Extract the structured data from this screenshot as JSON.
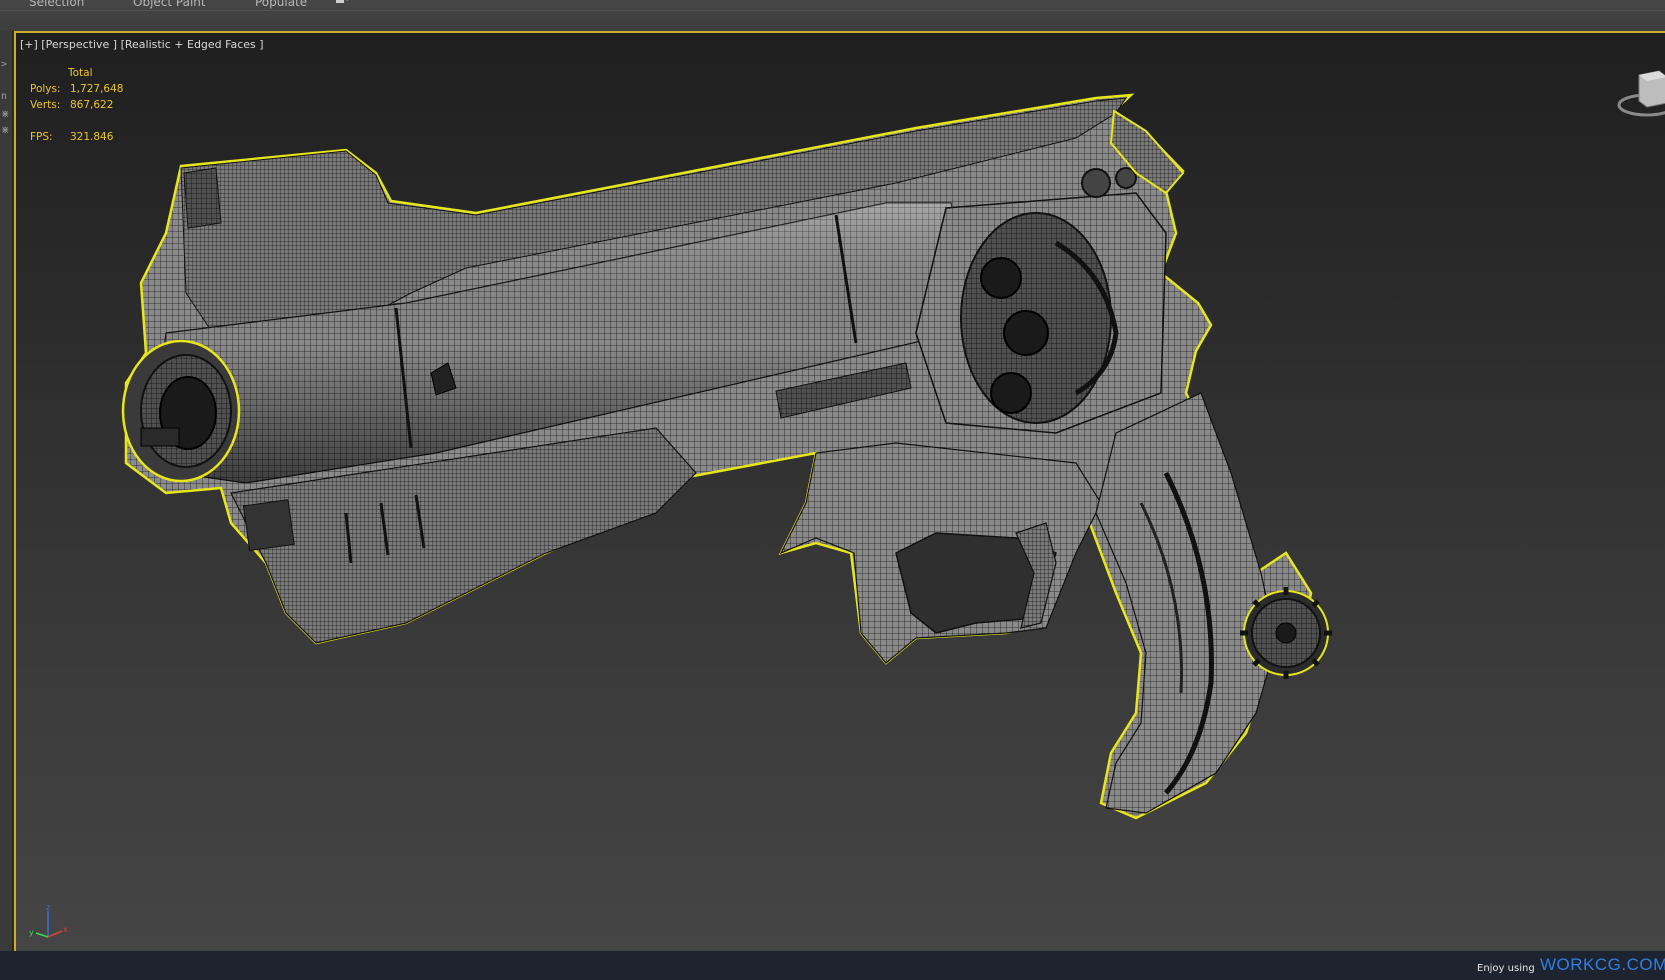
{
  "ribbon": {
    "tabs": [
      "Selection",
      "Object Paint",
      "Populate"
    ]
  },
  "viewport": {
    "label": "[+] [Perspective ] [Realistic + Edged Faces ]",
    "selection_highlight_color": "#e6e61a",
    "border_color": "#c9ad2b"
  },
  "stats": {
    "header": "Total",
    "polys_label": "Polys:",
    "polys_value": "1,727,648",
    "verts_label": "Verts:",
    "verts_value": "867,622",
    "fps_label": "FPS:",
    "fps_value": "321.846",
    "color": "#e8c52c"
  },
  "model": {
    "name": "revolver-wireframe-model"
  },
  "axis": {
    "x": "x",
    "y": "y",
    "z": "z"
  },
  "status": {
    "enjoy": "Enjoy using",
    "brand": "WORKCG.COM"
  },
  "icons": [
    "viewcube-icon",
    "axis-tripod-icon",
    "dropdown-icon"
  ]
}
